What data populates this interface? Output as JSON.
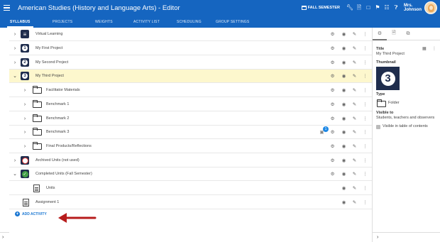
{
  "header": {
    "title": "American Studies (History and Language Arts) - Editor",
    "semester_label": "FALL SEMESTER",
    "user_name_line1": "Mrs.",
    "user_name_line2": "Johnson",
    "icons": [
      "wrench-icon",
      "document-icon",
      "clipboard-icon",
      "flag-icon",
      "grid-icon",
      "help-icon"
    ]
  },
  "tabs": [
    "SYLLABUS",
    "PROJECTS",
    "WEIGHTS",
    "ACTIVITY LIST",
    "SCHEDULING",
    "GROUP SETTINGS"
  ],
  "rows": [
    {
      "label": "Virtual Learning",
      "icon": "wifi-icon",
      "expanded": false
    },
    {
      "label": "My First Project",
      "icon": "number-1-icon",
      "number": "1",
      "expanded": false
    },
    {
      "label": "My Second Project",
      "icon": "number-2-icon",
      "number": "2",
      "expanded": false
    },
    {
      "label": "My Third Project",
      "icon": "number-3-icon",
      "number": "3",
      "expanded": true,
      "selected": true
    },
    {
      "label": "Facilitator Materials",
      "icon": "folder-icon"
    },
    {
      "label": "Benchmark 1",
      "icon": "folder-icon"
    },
    {
      "label": "Benchmark 2",
      "icon": "folder-icon"
    },
    {
      "label": "Benchmark 3",
      "icon": "folder-icon",
      "badge": "1"
    },
    {
      "label": "Final Products/Reflections",
      "icon": "folder-icon"
    },
    {
      "label": "Archived Units (not used)",
      "icon": "no-entry-icon"
    },
    {
      "label": "Completed Units (Fall Semester)",
      "icon": "check-circle-icon",
      "expanded": true
    },
    {
      "label": "Units",
      "icon": "document-icon"
    },
    {
      "label": "Assignment 1",
      "icon": "document-icon"
    }
  ],
  "add_activity": "ADD ACTIVITY",
  "panel": {
    "title_label": "Title",
    "title_value": "My Third Project",
    "thumbnail_label": "Thumbnail",
    "thumbnail_number": "3",
    "type_label": "Type",
    "type_value": "Folder",
    "visible_label": "Visible to",
    "visible_value": "Students, teachers and observers",
    "visible_toc": "Visible in table of contents"
  },
  "colors": {
    "primary": "#1565c0",
    "selected_row": "#fdf7cd",
    "dark_icon": "#1f2d4d",
    "arrow": "#b71c1c"
  }
}
